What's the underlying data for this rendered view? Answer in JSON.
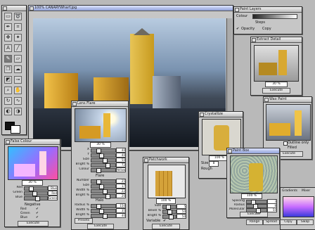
{
  "toolbox": {
    "tools": [
      "select-rect",
      "lasso",
      "pen",
      "crop",
      "move",
      "wand",
      "text",
      "line",
      "brush",
      "eraser",
      "clone",
      "airbrush",
      "fill",
      "picker",
      "zoom",
      "hand",
      "rotate",
      "smudge",
      "dodge",
      "burn"
    ]
  },
  "canvas": {
    "title": "100% CANARYWharf.jpg"
  },
  "tabs": {
    "labels": [
      "Brush",
      "Layers",
      "Colour"
    ]
  },
  "layers": {
    "title": "Paint Layers",
    "colour_label": "Colour",
    "steps_label": "Steps",
    "opacity_label": "Opacity",
    "copy_label": "Copy"
  },
  "extract_detail": {
    "title": "Extract Detail",
    "zoom": "30 %",
    "execute": "Execute"
  },
  "wax_paint": {
    "title": "Wax Paint",
    "outline_only": "Outline only",
    "filled": "Filled",
    "execute": "Execute"
  },
  "lens_flare": {
    "title": "Lens Flare",
    "zoom": "30 %",
    "rows": [
      {
        "label": "X",
        "value": "40"
      },
      {
        "label": "Y",
        "value": "40"
      },
      {
        "label": "Size",
        "value": "50"
      },
      {
        "label": "Bright %",
        "value": "72"
      },
      {
        "label": "Colour",
        "value": "Yellow"
      }
    ],
    "flare_label": "Flare",
    "flare_rows": [
      {
        "label": "Number",
        "value": "25"
      },
      {
        "label": "Size",
        "value": "17"
      },
      {
        "label": "Width %",
        "value": "22"
      },
      {
        "label": "Bright %",
        "value": "20"
      }
    ],
    "halo_label": "Halo",
    "halo_rows": [
      {
        "label": "Radius %",
        "value": "150"
      },
      {
        "label": "Width %",
        "value": "35"
      },
      {
        "label": "Bright %",
        "value": "40"
      }
    ],
    "presets": "Presets",
    "execute": "Execute"
  },
  "crystallize": {
    "title": "Crystallize",
    "zoom": "100 %",
    "size_label": "Size",
    "size": "8",
    "rough_label": "Rough"
  },
  "false_colour": {
    "title": "False Colour",
    "zoom": "30 %",
    "rows": [
      {
        "label": "Red",
        "value": "Blue"
      },
      {
        "label": "Green",
        "value": "Red"
      },
      {
        "label": "Blue",
        "value": "Green"
      }
    ],
    "negative_label": "Negative",
    "neg": [
      "Red",
      "Green",
      "Blue"
    ],
    "execute": "Execute"
  },
  "patchwork": {
    "title": "Patchwork",
    "zoom": "100 %",
    "rows": [
      {
        "label": "Size",
        "value": "5"
      },
      {
        "label": "Bevel %",
        "value": "50"
      },
      {
        "label": "Bright %",
        "value": "50"
      }
    ],
    "variable": "Variable",
    "execute": "Execute"
  },
  "paintbox": {
    "title": "Paint Box",
    "zoom": "100 %",
    "rows": [
      {
        "label": "Spacing",
        "value": "3"
      },
      {
        "label": "Radius",
        "value": "8"
      },
      {
        "label": "Molecular",
        "value": "50"
      }
    ],
    "execute": "Execute"
  },
  "gradients": {
    "tab1": "Gradients",
    "tab2": "Mixer",
    "buttons": [
      "Range",
      "Spread",
      "Copy",
      "Swap"
    ]
  }
}
